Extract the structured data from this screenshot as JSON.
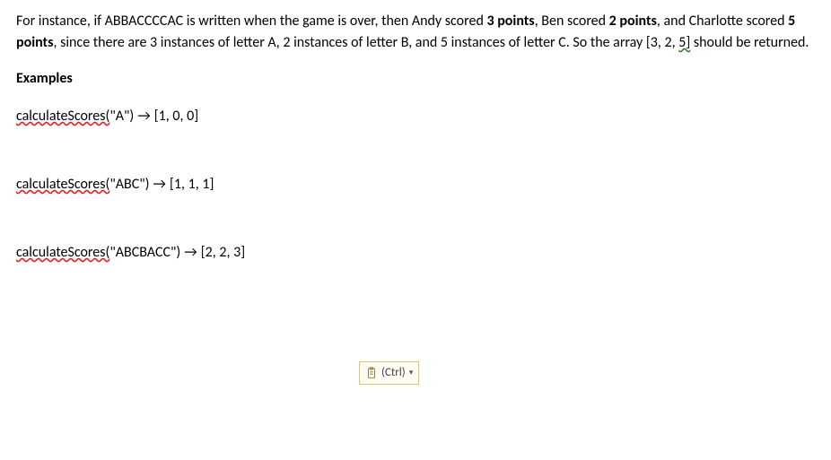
{
  "paragraph": {
    "pre1": "For instance, if ABBACCCCAC is written when the game is over, then Andy scored ",
    "bold1": "3 points",
    "mid1": ", Ben scored ",
    "bold2": "2 points",
    "mid2": ", and Charlotte scored ",
    "bold3": "5 points",
    "mid3": ", since there are 3 instances of letter A, 2 instances of letter B, and 5 instances of letter C. So the array [3, 2, ",
    "squiggle5": "5]",
    "end": " should be returned."
  },
  "examples_label": "Examples",
  "examples": [
    {
      "fn": "calculateScores(",
      "arg": "\"A\")",
      "arrow": "→",
      "result": "[1, 0, 0]"
    },
    {
      "fn": "calculateScores(",
      "arg": "\"ABC\")",
      "arrow": "→",
      "result": "[1, 1, 1]"
    },
    {
      "fn": "calculateScores(",
      "arg": "\"ABCBACC\")",
      "arrow": "→",
      "result": "[2, 2, 3]"
    }
  ],
  "paste_options": {
    "label": "(Ctrl)",
    "caret": "▾"
  }
}
